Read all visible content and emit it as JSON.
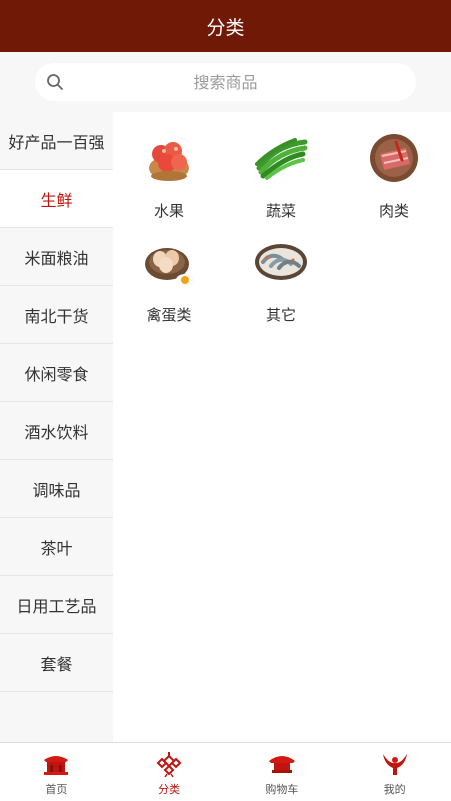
{
  "header": {
    "title": "分类"
  },
  "search": {
    "placeholder": "搜索商品",
    "icon": "search-icon"
  },
  "sidebar": {
    "items": [
      {
        "label": "好产品一百强"
      },
      {
        "label": "生鲜"
      },
      {
        "label": "米面粮油"
      },
      {
        "label": "南北干货"
      },
      {
        "label": "休闲零食"
      },
      {
        "label": "酒水饮料"
      },
      {
        "label": "调味品"
      },
      {
        "label": "茶叶"
      },
      {
        "label": "日用工艺品"
      },
      {
        "label": "套餐"
      }
    ],
    "active_index": 1
  },
  "categories": [
    {
      "label": "水果",
      "icon": "fruit-basket-image"
    },
    {
      "label": "蔬菜",
      "icon": "green-beans-image"
    },
    {
      "label": "肉类",
      "icon": "meat-plate-image"
    },
    {
      "label": "禽蛋类",
      "icon": "eggs-basket-image"
    },
    {
      "label": "其它",
      "icon": "shrimp-plate-image"
    }
  ],
  "tabbar": {
    "items": [
      {
        "label": "首页",
        "icon": "home-palace-icon"
      },
      {
        "label": "分类",
        "icon": "category-knot-icon"
      },
      {
        "label": "购物车",
        "icon": "cart-roof-icon"
      },
      {
        "label": "我的",
        "icon": "profile-bird-icon"
      }
    ],
    "active_index": 1
  },
  "colors": {
    "header_bg": "#6f1906",
    "accent": "#c0150e",
    "sidebar_bg": "#f7f7f7"
  }
}
